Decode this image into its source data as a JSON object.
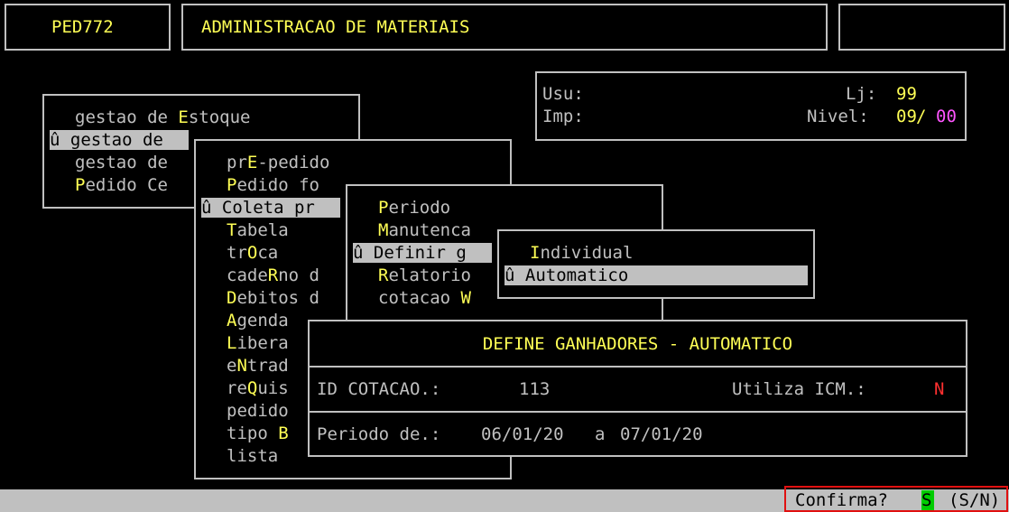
{
  "header": {
    "program_code": "PED772",
    "title": "ADMINISTRACAO DE MATERIAIS",
    "right_box": ""
  },
  "user_panel": {
    "usu_label": "Usu:",
    "imp_label": "Imp:",
    "lj_label": "Lj:",
    "lj_value": "99",
    "nivel_label": "Nivel:",
    "nivel_value_a": "09",
    "nivel_sep": "/",
    "nivel_value_b": "00"
  },
  "menu1": {
    "items": [
      {
        "pre": "gestao de ",
        "hot": "E",
        "post": "stoque"
      },
      {
        "marker": "û",
        "text": " gestao de"
      },
      {
        "pre": "gestao de",
        "hot": "",
        "post": ""
      },
      {
        "pre": "",
        "hot": "P",
        "post": "edido Ce"
      }
    ]
  },
  "menu2": {
    "items": [
      {
        "pre": "pr",
        "hot": "E",
        "post": "-pedido"
      },
      {
        "pre": "",
        "hot": "P",
        "post": "edido fo"
      },
      {
        "marker": "û",
        "text": " Coleta pr"
      },
      {
        "pre": "",
        "hot": "T",
        "post": "abela"
      },
      {
        "pre": "tr",
        "hot": "O",
        "post": "ca"
      },
      {
        "pre": "cade",
        "hot": "R",
        "post": "no d"
      },
      {
        "pre": "",
        "hot": "D",
        "post": "ebitos d"
      },
      {
        "pre": "",
        "hot": "A",
        "post": "genda"
      },
      {
        "pre": "",
        "hot": "L",
        "post": "ibera"
      },
      {
        "pre": "e",
        "hot": "N",
        "post": "trad"
      },
      {
        "pre": "re",
        "hot": "Q",
        "post": "uis"
      },
      {
        "pre": "pedido",
        "hot": "",
        "post": ""
      },
      {
        "pre": "tipo ",
        "hot": "B",
        "post": ""
      },
      {
        "pre": "lista",
        "hot": "",
        "post": ""
      }
    ]
  },
  "menu3": {
    "items": [
      {
        "pre": "",
        "hot": "P",
        "post": "eriodo"
      },
      {
        "pre": "",
        "hot": "M",
        "post": "anutenca"
      },
      {
        "marker": "û",
        "text": " Definir g"
      },
      {
        "pre": "",
        "hot": "R",
        "post": "elatorio"
      },
      {
        "pre": "cotacao ",
        "hot": "W",
        "post": ""
      }
    ]
  },
  "menu4": {
    "items": [
      {
        "pre": "",
        "hot": "I",
        "post": "ndividual"
      },
      {
        "marker": "û",
        "text": " Automatico"
      }
    ]
  },
  "dialog": {
    "title": "DEFINE GANHADORES - AUTOMATICO",
    "id_label": "ID COTACAO.:",
    "id_value": "113",
    "icm_label": "Utiliza ICM.:",
    "icm_value": "N",
    "periodo_label": "Periodo de.:",
    "periodo_from": "06/01/20",
    "periodo_sep": "a",
    "periodo_to": "07/01/20"
  },
  "status": {
    "confirm_label": "Confirma?",
    "confirm_value": "S",
    "options": "(S/N)"
  },
  "colors": {
    "background": "#000000",
    "text": "#c0c0c0",
    "hotkey": "#ffff55",
    "highlight": "#c0c0c0",
    "accent_magenta": "#ff55ff",
    "accent_red": "#ff3030",
    "confirm_green": "#00cc00"
  }
}
